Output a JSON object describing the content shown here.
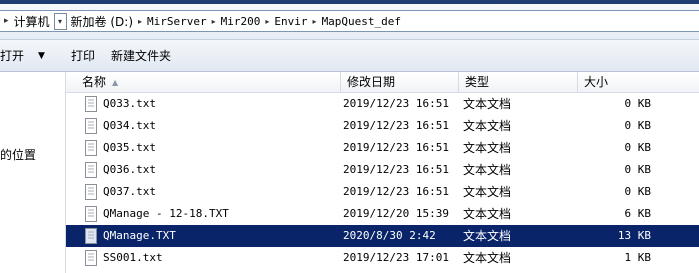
{
  "address": {
    "dropdown_arrow": "▾",
    "crumbs": [
      "计算机",
      "新加卷 (D:)",
      "MirServer",
      "Mir200",
      "Envir",
      "MapQuest_def"
    ]
  },
  "toolbar": {
    "open_label": "打开",
    "print_label": "打印",
    "new_folder_label": "新建文件夹"
  },
  "nav": {
    "partial_text": "的位置"
  },
  "columns": {
    "name": "名称",
    "date": "修改日期",
    "type": "类型",
    "size": "大小"
  },
  "files": [
    {
      "name": "Q033.txt",
      "date": "2019/12/23 16:51",
      "type": "文本文档",
      "size": "0 KB"
    },
    {
      "name": "Q034.txt",
      "date": "2019/12/23 16:51",
      "type": "文本文档",
      "size": "0 KB"
    },
    {
      "name": "Q035.txt",
      "date": "2019/12/23 16:51",
      "type": "文本文档",
      "size": "0 KB"
    },
    {
      "name": "Q036.txt",
      "date": "2019/12/23 16:51",
      "type": "文本文档",
      "size": "0 KB"
    },
    {
      "name": "Q037.txt",
      "date": "2019/12/23 16:51",
      "type": "文本文档",
      "size": "0 KB"
    },
    {
      "name": "QManage - 12-18.TXT",
      "date": "2019/12/20 15:39",
      "type": "文本文档",
      "size": "6 KB"
    },
    {
      "name": "QManage.TXT",
      "date": "2020/8/30 2:42",
      "type": "文本文档",
      "size": "13 KB",
      "selected": true
    },
    {
      "name": "SS001.txt",
      "date": "2019/12/23 17:01",
      "type": "文本文档",
      "size": "1 KB"
    }
  ],
  "colors": {
    "selection": "#0a246a",
    "title_band": "#1f3f73"
  }
}
